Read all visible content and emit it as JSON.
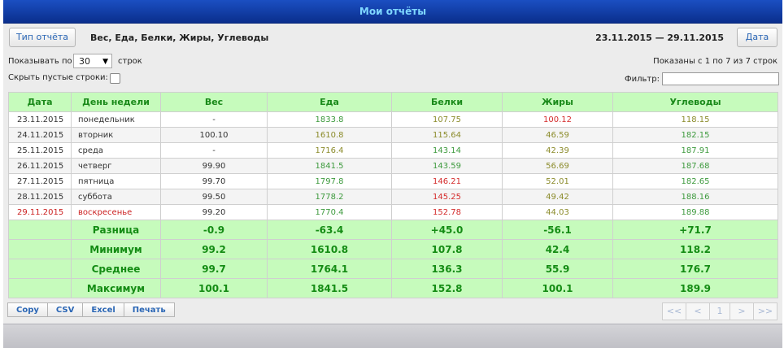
{
  "title": "Мои отчёты",
  "report_type_button": "Тип отчёта",
  "report_columns_label": "Вес, Еда, Белки, Жиры, Углеводы",
  "date_range": "23.11.2015 — 29.11.2015",
  "date_button": "Дата",
  "show_per": {
    "before": "Показывать по",
    "value": "30",
    "after": "строк"
  },
  "hide_empty_label": "Скрыть пустые строки:",
  "info_text": "Показаны с 1 по 7 из 7 строк",
  "filter_label": "Фильтр:",
  "columns": [
    "Дата",
    "День недели",
    "Вес",
    "Еда",
    "Белки",
    "Жиры",
    "Углеводы"
  ],
  "rows": [
    {
      "date": "23.11.2015",
      "day": "понедельник",
      "weight": "-",
      "food": "1833.8",
      "protein": "107.75",
      "fat": "100.12",
      "carbs": "118.15",
      "colors": {
        "food": "green",
        "protein": "olive",
        "fat": "red",
        "carbs": "olive"
      }
    },
    {
      "date": "24.11.2015",
      "day": "вторник",
      "weight": "100.10",
      "food": "1610.8",
      "protein": "115.64",
      "fat": "46.59",
      "carbs": "182.15",
      "colors": {
        "food": "olive",
        "protein": "olive",
        "fat": "olive",
        "carbs": "green"
      }
    },
    {
      "date": "25.11.2015",
      "day": "среда",
      "weight": "-",
      "food": "1716.4",
      "protein": "143.14",
      "fat": "42.39",
      "carbs": "187.91",
      "colors": {
        "food": "olive",
        "protein": "green",
        "fat": "olive",
        "carbs": "green"
      }
    },
    {
      "date": "26.11.2015",
      "day": "четверг",
      "weight": "99.90",
      "food": "1841.5",
      "protein": "143.59",
      "fat": "56.69",
      "carbs": "187.68",
      "colors": {
        "food": "green",
        "protein": "green",
        "fat": "olive",
        "carbs": "green"
      }
    },
    {
      "date": "27.11.2015",
      "day": "пятница",
      "weight": "99.70",
      "food": "1797.8",
      "protein": "146.21",
      "fat": "52.01",
      "carbs": "182.65",
      "colors": {
        "food": "green",
        "protein": "red",
        "fat": "olive",
        "carbs": "green"
      }
    },
    {
      "date": "28.11.2015",
      "day": "суббота",
      "weight": "99.50",
      "food": "1778.2",
      "protein": "145.25",
      "fat": "49.42",
      "carbs": "188.16",
      "colors": {
        "food": "green",
        "protein": "red",
        "fat": "olive",
        "carbs": "green"
      }
    },
    {
      "date": "29.11.2015",
      "day": "воскресенье",
      "weight": "99.20",
      "food": "1770.4",
      "protein": "152.78",
      "fat": "44.03",
      "carbs": "189.88",
      "colors": {
        "food": "green",
        "protein": "red",
        "fat": "olive",
        "carbs": "green"
      }
    }
  ],
  "summary": [
    {
      "label": "Разница",
      "weight": "-0.9",
      "food": "-63.4",
      "protein": "+45.0",
      "fat": "-56.1",
      "carbs": "+71.7"
    },
    {
      "label": "Минимум",
      "weight": "99.2",
      "food": "1610.8",
      "protein": "107.8",
      "fat": "42.4",
      "carbs": "118.2"
    },
    {
      "label": "Среднее",
      "weight": "99.7",
      "food": "1764.1",
      "protein": "136.3",
      "fat": "55.9",
      "carbs": "176.7"
    },
    {
      "label": "Максимум",
      "weight": "100.1",
      "food": "1841.5",
      "protein": "152.8",
      "fat": "100.1",
      "carbs": "189.9"
    }
  ],
  "export_buttons": [
    "Copy",
    "CSV",
    "Excel",
    "Печать"
  ],
  "pager": [
    "<<",
    "<",
    "1",
    ">",
    ">>"
  ],
  "colors": {
    "green": "#3d9a3d",
    "olive": "#8b8b2a",
    "red": "#d42b2b",
    "header_bg": "#c6fbbc",
    "title_bg": "#1b4fc2"
  }
}
